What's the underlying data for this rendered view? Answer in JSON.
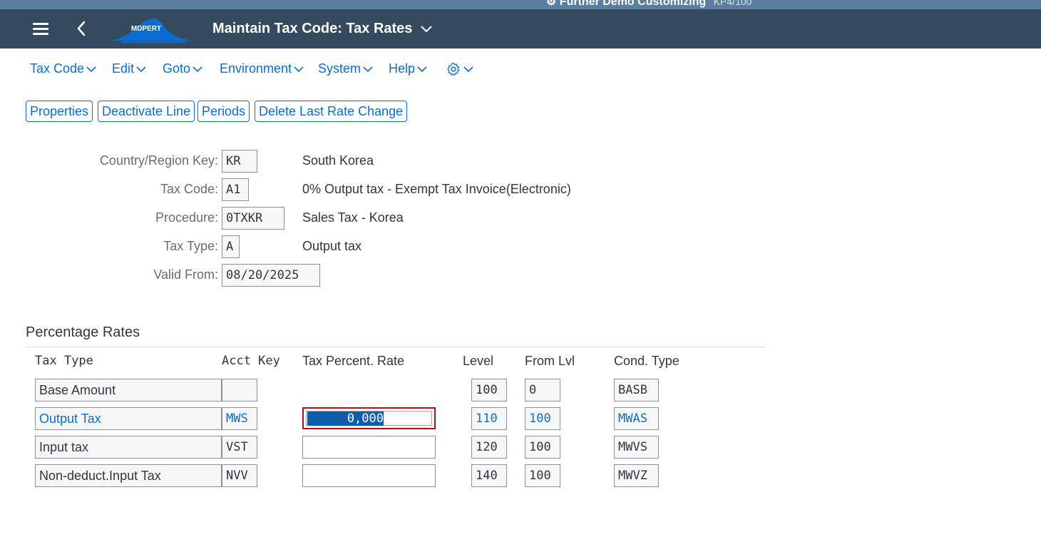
{
  "shell": {
    "system_info": "Further Demo Customizing",
    "system_id": "KP4/100",
    "logo_text": "MDPERT",
    "title": "Maintain Tax Code: Tax Rates"
  },
  "menu": [
    "Tax Code",
    "Edit",
    "Goto",
    "Environment",
    "System",
    "Help"
  ],
  "toolbar": [
    "Properties",
    "Deactivate Line",
    "Periods",
    "Delete Last Rate Change"
  ],
  "header": {
    "country": {
      "label": "Country/Region Key:",
      "value": "KR",
      "desc": "South Korea"
    },
    "tax_code": {
      "label": "Tax Code:",
      "value": "A1",
      "desc": "0% Output tax - Exempt Tax Invoice(Electronic)"
    },
    "procedure": {
      "label": "Procedure:",
      "value": "0TXKR",
      "desc": "Sales Tax - Korea"
    },
    "tax_type": {
      "label": "Tax Type:",
      "value": "A",
      "desc": "Output tax"
    },
    "valid_from": {
      "label": "Valid From:",
      "value": "08/20/2025"
    }
  },
  "rates": {
    "title": "Percentage Rates",
    "columns": [
      "Tax Type",
      "Acct Key",
      "Tax Percent. Rate",
      "Level",
      "From Lvl",
      "Cond. Type"
    ],
    "rows": [
      {
        "tax_type": "Base Amount",
        "acct_key": "",
        "rate": "",
        "level": "100",
        "from_lvl": "0",
        "cond_type": "BASB"
      },
      {
        "tax_type": "Output Tax",
        "acct_key": "MWS",
        "rate": "0,000",
        "level": "110",
        "from_lvl": "100",
        "cond_type": "MWAS"
      },
      {
        "tax_type": "Input tax",
        "acct_key": "VST",
        "rate": "",
        "level": "120",
        "from_lvl": "100",
        "cond_type": "MWVS"
      },
      {
        "tax_type": "Non-deduct.Input Tax",
        "acct_key": "NVV",
        "rate": "",
        "level": "140",
        "from_lvl": "100",
        "cond_type": "MWVZ"
      }
    ]
  },
  "colors": {
    "shell": "#354a5f",
    "accent": "#0a6ed1",
    "focus_border": "#a7121b",
    "selection": "#0b5ea8"
  }
}
